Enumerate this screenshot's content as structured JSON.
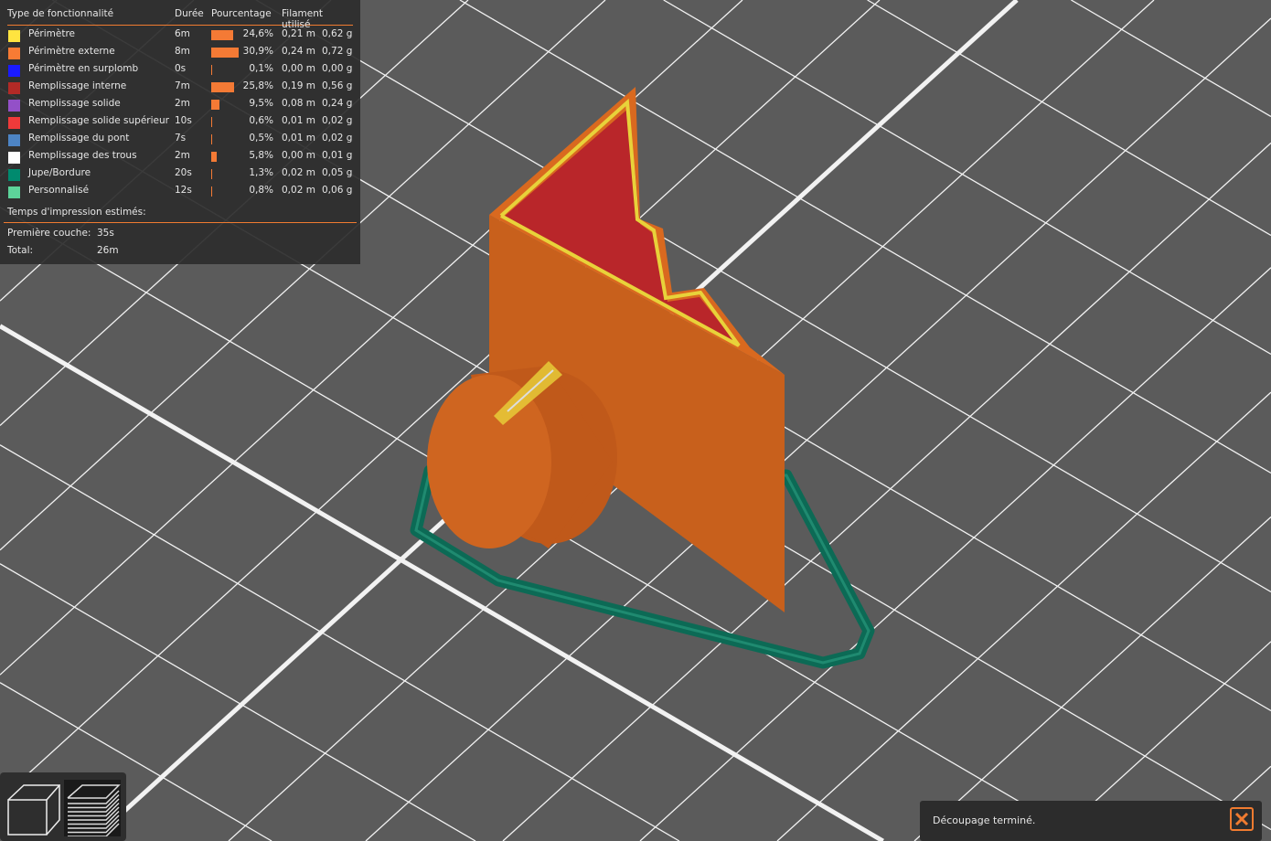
{
  "legend": {
    "headers": {
      "type": "Type de fonctionnalité",
      "duration": "Durée",
      "percent": "Pourcentage",
      "filament": "Filament utilisé"
    },
    "rows": [
      {
        "label": "Périmètre",
        "color": "#ffe440",
        "duration": "6m",
        "percent_text": "24,6%",
        "percent": 24.6,
        "length": "0,21 m",
        "weight": "0,62 g"
      },
      {
        "label": "Périmètre externe",
        "color": "#f77b34",
        "duration": "8m",
        "percent_text": "30,9%",
        "percent": 30.9,
        "length": "0,24 m",
        "weight": "0,72 g"
      },
      {
        "label": "Périmètre en surplomb",
        "color": "#1a1aff",
        "duration": "0s",
        "percent_text": "0,1%",
        "percent": 0.1,
        "length": "0,00 m",
        "weight": "0,00 g"
      },
      {
        "label": "Remplissage interne",
        "color": "#b22a26",
        "duration": "7m",
        "percent_text": "25,8%",
        "percent": 25.8,
        "length": "0,19 m",
        "weight": "0,56 g"
      },
      {
        "label": "Remplissage solide",
        "color": "#9350c8",
        "duration": "2m",
        "percent_text": "9,5%",
        "percent": 9.5,
        "length": "0,08 m",
        "weight": "0,24 g"
      },
      {
        "label": "Remplissage solide supérieur",
        "color": "#ef3a3a",
        "duration": "10s",
        "percent_text": "0,6%",
        "percent": 0.6,
        "length": "0,01 m",
        "weight": "0,02 g"
      },
      {
        "label": "Remplissage du pont",
        "color": "#4d84c4",
        "duration": "7s",
        "percent_text": "0,5%",
        "percent": 0.5,
        "length": "0,01 m",
        "weight": "0,02 g"
      },
      {
        "label": "Remplissage des trous",
        "color": "#ffffff",
        "duration": "2m",
        "percent_text": "5,8%",
        "percent": 5.8,
        "length": "0,00 m",
        "weight": "0,01 g"
      },
      {
        "label": "Jupe/Bordure",
        "color": "#008a6e",
        "duration": "20s",
        "percent_text": "1,3%",
        "percent": 1.3,
        "length": "0,02 m",
        "weight": "0,05 g"
      },
      {
        "label": "Personnalisé",
        "color": "#5dd39a",
        "duration": "12s",
        "percent_text": "0,8%",
        "percent": 0.8,
        "length": "0,02 m",
        "weight": "0,06 g"
      }
    ],
    "estimated_title": "Temps d'impression estimés:",
    "first_layer_label": "Première couche:",
    "first_layer_value": "35s",
    "total_label": "Total:",
    "total_value": "26m"
  },
  "view_buttons": [
    {
      "icon": "cube-icon"
    },
    {
      "icon": "layers-icon"
    }
  ],
  "notification": {
    "message": "Découpage terminé.",
    "close_icon": "close-icon"
  },
  "accent": "#f07b30"
}
